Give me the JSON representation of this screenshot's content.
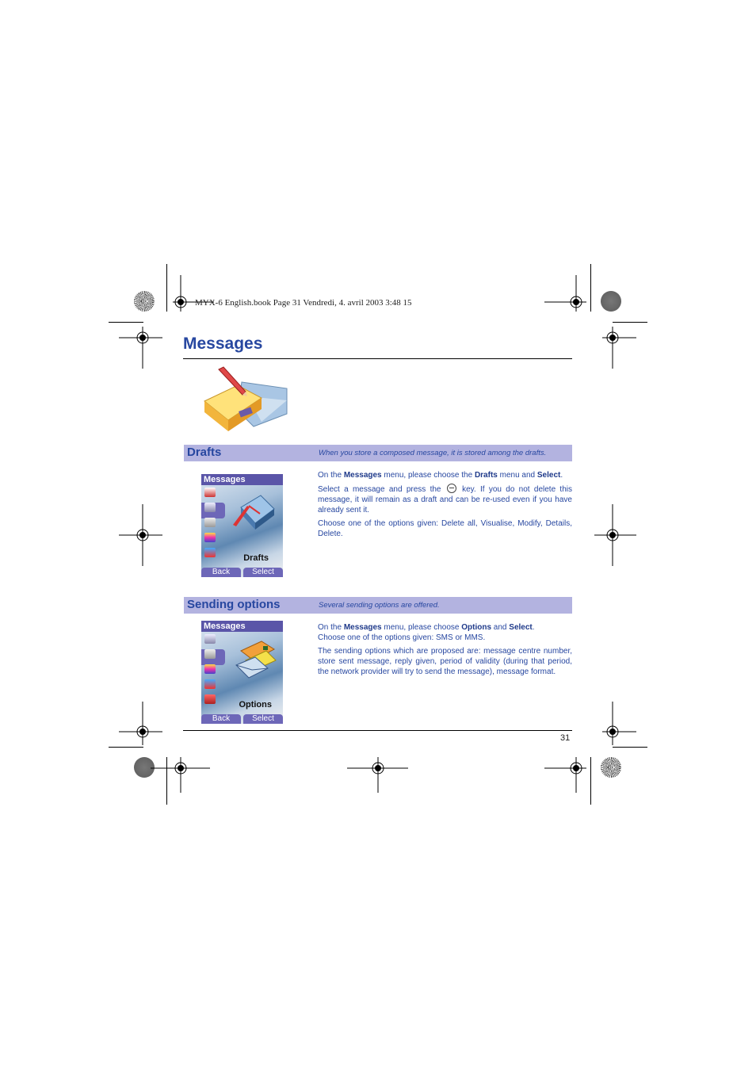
{
  "slug": "MYX-6 English.book  Page 31  Vendredi, 4. avril 2003  3:48 15",
  "page_title": "Messages",
  "hero_icon": "drafts-notepad-pencil-icon",
  "sections": [
    {
      "title": "Drafts",
      "description": "When you store a composed message, it is stored among the drafts.",
      "phone": {
        "header": "Messages",
        "label": "Drafts",
        "soft_left": "Back",
        "soft_right": "Select",
        "icons": [
          "envelope-icon",
          "drafts-icon",
          "options-icon",
          "memory-icon",
          "templates-icon"
        ]
      },
      "paragraphs": [
        {
          "parts": [
            "On the ",
            "Messages",
            " menu, please choose the ",
            "Drafts",
            " menu and ",
            "Select",
            "."
          ]
        },
        {
          "before_key": "Select a message and press the ",
          "key_icon": "ok-key-icon",
          "after_key": " key. If you do not delete this message, it will remain as a draft and can be re-used even if you have already sent it."
        },
        {
          "text": "Choose one of the options given: Delete all, Visualise, Modify, Details, Delete."
        }
      ]
    },
    {
      "title": "Sending options",
      "description": "Several sending options are offered.",
      "phone": {
        "header": "Messages",
        "label": "Options",
        "soft_left": "Back",
        "soft_right": "Select",
        "icons": [
          "drafts-icon",
          "options-icon",
          "memory-icon",
          "templates-icon",
          "compose-icon"
        ]
      },
      "paragraphs": [
        {
          "parts": [
            "On the ",
            "Messages",
            " menu, please choose ",
            "Options",
            " and ",
            "Select",
            "."
          ],
          "line2": "Choose one of the options given: SMS or MMS."
        },
        {
          "text": "The sending options which are proposed are: message centre number, store sent message, reply given, period of validity (during that period, the network provider will try to send the message), message format."
        }
      ]
    }
  ],
  "page_number": "31",
  "colors": {
    "title_blue": "#2747a0",
    "section_bar": "#b3b3e0",
    "phone_header": "#5a55a8"
  }
}
